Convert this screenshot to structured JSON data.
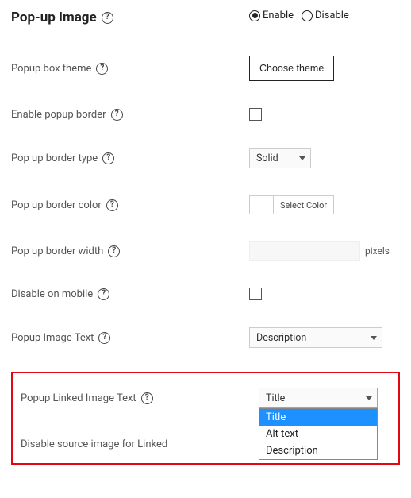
{
  "section": {
    "title": "Pop-up Image"
  },
  "enable_radio": {
    "enable_label": "Enable",
    "disable_label": "Disable",
    "selected": "enable"
  },
  "fields": {
    "theme": {
      "label": "Popup box theme",
      "button": "Choose theme"
    },
    "border": {
      "label": "Enable popup border"
    },
    "border_type": {
      "label": "Pop up border type",
      "value": "Solid"
    },
    "border_color": {
      "label": "Pop up border color",
      "button": "Select Color"
    },
    "border_width": {
      "label": "Pop up border width",
      "unit": "pixels"
    },
    "disable_mobile": {
      "label": "Disable on mobile"
    },
    "image_text": {
      "label": "Popup Image Text",
      "value": "Description"
    },
    "linked_text": {
      "label": "Popup Linked Image Text",
      "value": "Title",
      "options": [
        "Title",
        "Alt text",
        "Description"
      ]
    },
    "disable_source": {
      "label": "Disable source image for Linked"
    }
  }
}
